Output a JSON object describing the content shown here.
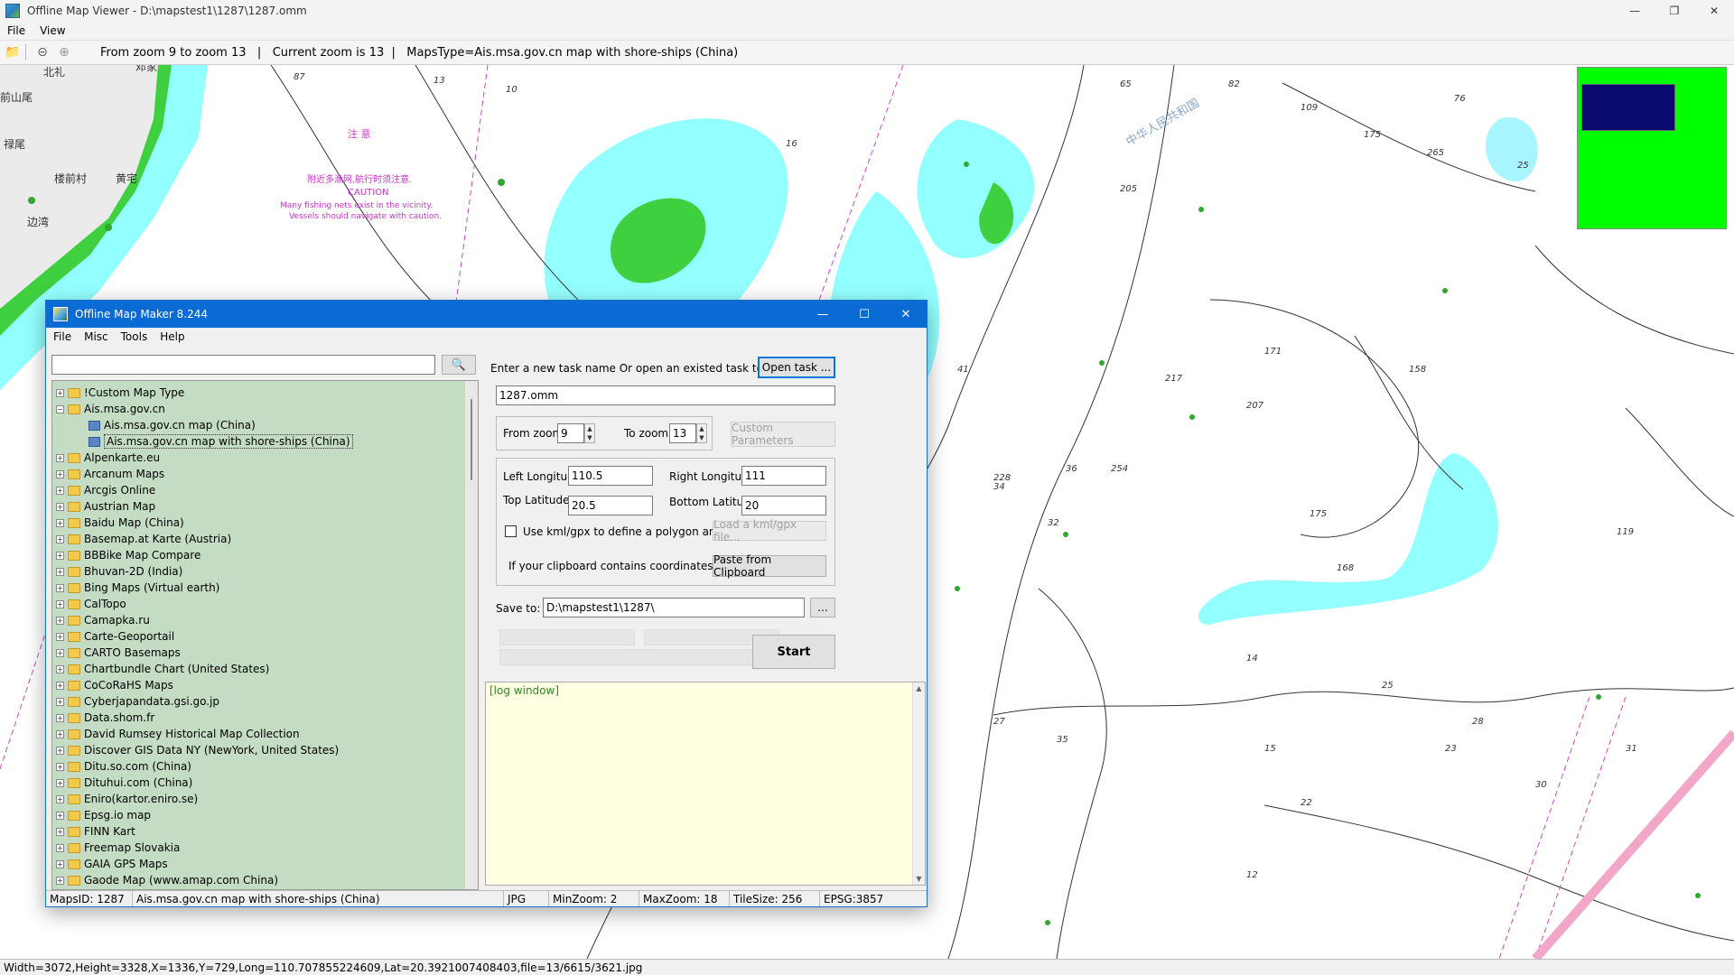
{
  "viewer": {
    "title": "Offline Map Viewer - D:\\mapstest1\\1287\\1287.omm",
    "menu": [
      "File",
      "View"
    ],
    "toolbar_info": "From zoom 9 to zoom 13   |   Current zoom is 13  |   MapsType=Ais.msa.gov.cn map with shore-ships (China)",
    "status": "Width=3072,Height=3328,X=1336,Y=729,Long=110.707855224609,Lat=20.3921007408403,file=13/6615/3621.jpg",
    "icons": [
      "open-folder-icon",
      "zoom-out-icon",
      "zoom-in-icon"
    ]
  },
  "map": {
    "labels_cn": [
      "北礼",
      "邓家",
      "前山尾",
      "禄尾",
      "楼前村",
      "黄宅",
      "边湾",
      "注 意",
      "附近多渔网,航行时须注意.",
      "CAUTION",
      "Many fishing nets exist in the vicinity.",
      "Vessels should navigate with caution.",
      "中华人民共和国"
    ],
    "soundings": [
      "87",
      "13",
      "10",
      "16",
      "65",
      "82",
      "109",
      "76",
      "175",
      "265",
      "25",
      "205",
      "171",
      "158",
      "217",
      "207",
      "254",
      "228",
      "175",
      "119",
      "168",
      "41",
      "34",
      "36",
      "32",
      "27",
      "35",
      "28",
      "25",
      "23",
      "31",
      "30",
      "22",
      "12",
      "14",
      "15"
    ],
    "minimap_colors": {
      "background": "#00ff00",
      "viewport": "#0a0a6e"
    }
  },
  "dialog": {
    "title": "Offline Map Maker 8.244",
    "menu": [
      "File",
      "Misc",
      "Tools",
      "Help"
    ],
    "search": {
      "value": "",
      "placeholder": ""
    },
    "tree": [
      {
        "label": "!Custom Map Type",
        "level": 0,
        "expanded": false,
        "type": "folder"
      },
      {
        "label": "Ais.msa.gov.cn",
        "level": 0,
        "expanded": true,
        "type": "folder"
      },
      {
        "label": "Ais.msa.gov.cn map (China)",
        "level": 1,
        "type": "map"
      },
      {
        "label": "Ais.msa.gov.cn map with shore-ships (China)",
        "level": 1,
        "type": "map",
        "selected": true
      },
      {
        "label": "Alpenkarte.eu",
        "level": 0,
        "type": "folder"
      },
      {
        "label": "Arcanum Maps",
        "level": 0,
        "type": "folder"
      },
      {
        "label": "Arcgis Online",
        "level": 0,
        "type": "folder"
      },
      {
        "label": "Austrian Map",
        "level": 0,
        "type": "folder"
      },
      {
        "label": "Baidu Map (China)",
        "level": 0,
        "type": "folder"
      },
      {
        "label": "Basemap.at Karte (Austria)",
        "level": 0,
        "type": "folder"
      },
      {
        "label": "BBBike Map Compare",
        "level": 0,
        "type": "folder"
      },
      {
        "label": "Bhuvan-2D (India)",
        "level": 0,
        "type": "folder"
      },
      {
        "label": "Bing Maps (Virtual earth)",
        "level": 0,
        "type": "folder"
      },
      {
        "label": "CalTopo",
        "level": 0,
        "type": "folder"
      },
      {
        "label": "Camapka.ru",
        "level": 0,
        "type": "folder"
      },
      {
        "label": "Carte-Geoportail",
        "level": 0,
        "type": "folder"
      },
      {
        "label": "CARTO Basemaps",
        "level": 0,
        "type": "folder"
      },
      {
        "label": "Chartbundle Chart (United States)",
        "level": 0,
        "type": "folder"
      },
      {
        "label": "CoCoRaHS Maps",
        "level": 0,
        "type": "folder"
      },
      {
        "label": "Cyberjapandata.gsi.go.jp",
        "level": 0,
        "type": "folder"
      },
      {
        "label": "Data.shom.fr",
        "level": 0,
        "type": "folder"
      },
      {
        "label": "David Rumsey Historical Map Collection",
        "level": 0,
        "type": "folder"
      },
      {
        "label": "Discover GIS Data NY (NewYork, United States)",
        "level": 0,
        "type": "folder"
      },
      {
        "label": "Ditu.so.com (China)",
        "level": 0,
        "type": "folder"
      },
      {
        "label": "Dituhui.com (China)",
        "level": 0,
        "type": "folder"
      },
      {
        "label": "Eniro(kartor.eniro.se)",
        "level": 0,
        "type": "folder"
      },
      {
        "label": "Epsg.io map",
        "level": 0,
        "type": "folder"
      },
      {
        "label": "FINN Kart",
        "level": 0,
        "type": "folder"
      },
      {
        "label": "Freemap Slovakia",
        "level": 0,
        "type": "folder"
      },
      {
        "label": "GAIA GPS Maps",
        "level": 0,
        "type": "folder"
      },
      {
        "label": "Gaode Map (www.amap.com China)",
        "level": 0,
        "type": "folder"
      }
    ],
    "task_prompt": "Enter a new task name Or open an existed task to continue:",
    "open_task_label": "Open task ...",
    "task_name": "1287.omm",
    "from_zoom_label": "From zoom",
    "from_zoom": "9",
    "to_zoom_label": "To zoom",
    "to_zoom": "13",
    "custom_params_label": "Custom Parameters",
    "left_lon_label": "Left Longitude",
    "left_lon": "110.5",
    "right_lon_label": "Right Longitude",
    "right_lon": "111",
    "top_lat_label": "Top Latitude",
    "top_lat": "20.5",
    "bottom_lat_label": "Bottom Latitude",
    "bottom_lat": "20",
    "kml_checkbox_label": "Use kml/gpx to define a polygon area",
    "kml_checked": false,
    "load_kml_label": "Load a kml/gpx file...",
    "clipboard_prompt": "If your clipboard contains coordinates values:",
    "paste_label": "Paste from Clipboard",
    "save_to_label": "Save to:",
    "save_to": "D:\\mapstest1\\1287\\",
    "browse_label": "...",
    "start_label": "Start",
    "log_label": "[log window]",
    "status": {
      "maps_id": "MapsID: 1287",
      "map_name": "Ais.msa.gov.cn map with shore-ships (China)",
      "format": "JPG",
      "min_zoom": "MinZoom: 2",
      "max_zoom": "MaxZoom: 18",
      "tile_size": "TileSize: 256",
      "epsg": "EPSG:3857"
    }
  }
}
